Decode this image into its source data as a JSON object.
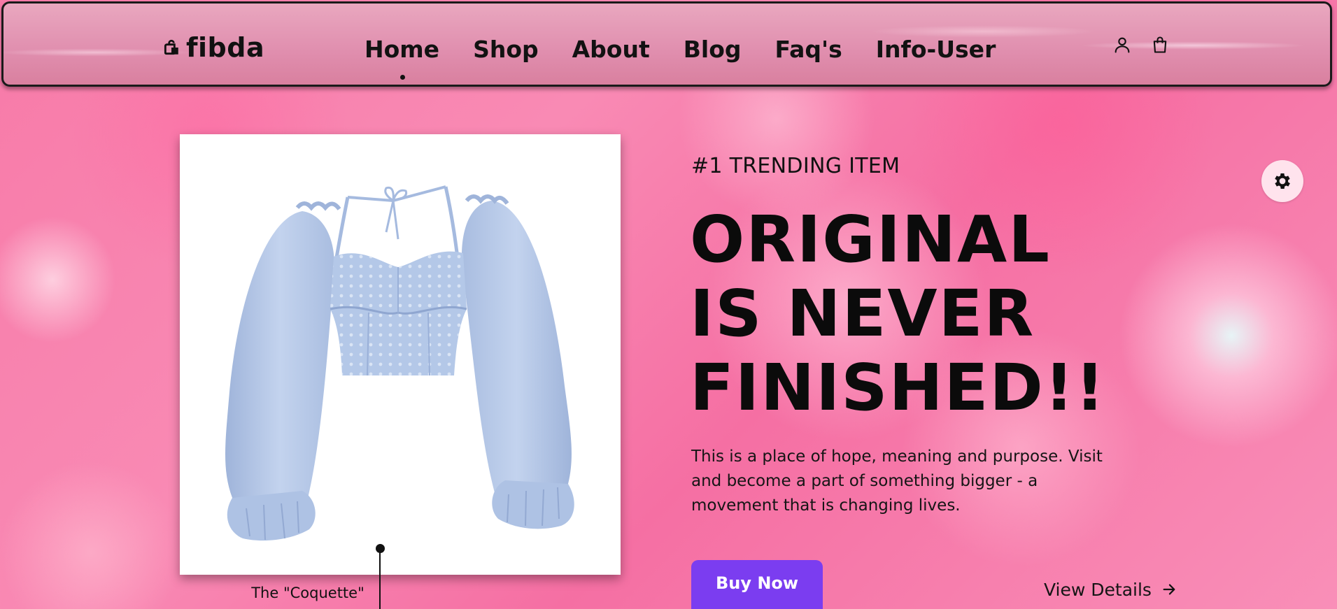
{
  "header": {
    "brand": "fibda",
    "brand_icon": "shopping-bag-icon",
    "nav": [
      {
        "label": "Home",
        "active": true
      },
      {
        "label": "Shop",
        "active": false
      },
      {
        "label": "About",
        "active": false
      },
      {
        "label": "Blog",
        "active": false
      },
      {
        "label": "Faq's",
        "active": false
      },
      {
        "label": "Info-User",
        "active": false
      }
    ],
    "icons": [
      "user-icon",
      "shopping-bag-icon"
    ]
  },
  "hero": {
    "eyebrow": "#1 TRENDING ITEM",
    "headline": [
      "ORIGINAL",
      "IS NEVER",
      "FINISHED!!"
    ],
    "description": "This is a place of hope, meaning and purpose. Visit and become a part of something bigger - a movement that is changing lives.",
    "buy_label": "Buy Now",
    "details_label": "View Details",
    "details_icon": "arrow-right-icon"
  },
  "product": {
    "caption": "The \"Coquette\"",
    "image": "light-blue-puff-sleeve-crop-top"
  },
  "settings": {
    "icon": "gear-icon"
  },
  "colors": {
    "accent": "#7b3df0",
    "background": "#f77aa8",
    "text": "#111111",
    "garment": "#b4c8e8"
  }
}
